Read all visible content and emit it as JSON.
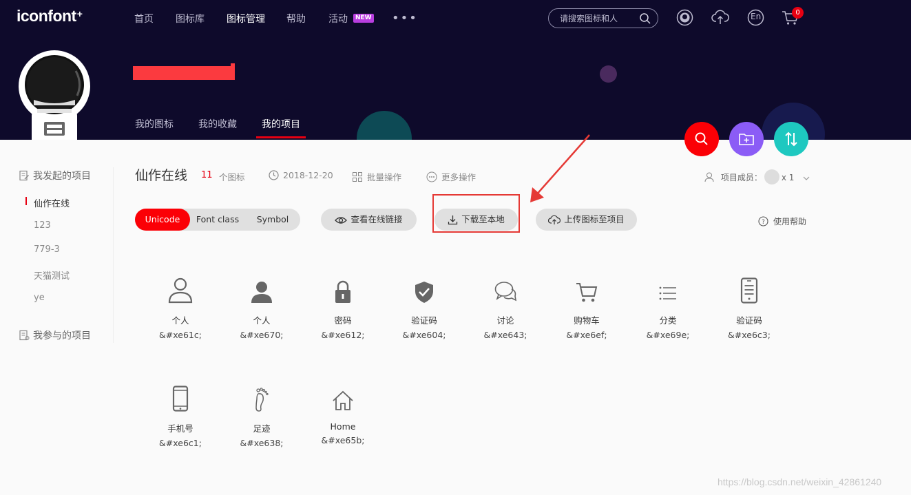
{
  "logo": {
    "text": "iconfont",
    "plus": "+"
  },
  "nav": {
    "items": [
      {
        "label": "首页"
      },
      {
        "label": "图标库"
      },
      {
        "label": "图标管理"
      },
      {
        "label": "帮助"
      },
      {
        "label": "活动"
      }
    ],
    "active": "图标管理",
    "new_badge": "NEW",
    "more": "•••"
  },
  "search": {
    "placeholder": "请搜索图标和人"
  },
  "cart": {
    "count": "0"
  },
  "lang": "En",
  "banner": {
    "tabs": [
      {
        "label": "我的图标"
      },
      {
        "label": "我的收藏"
      },
      {
        "label": "我的项目"
      }
    ],
    "active_tab": "我的项目"
  },
  "sidebar": {
    "started_heading": "我发起的项目",
    "items": [
      {
        "label": "仙作在线"
      },
      {
        "label": "123"
      },
      {
        "label": "779-3"
      },
      {
        "label": "天猫测试"
      },
      {
        "label": "ye"
      }
    ],
    "joined_heading": "我参与的项目"
  },
  "project": {
    "title": "仙作在线",
    "count": "11",
    "count_unit": "个图标",
    "date": "2018-12-20",
    "batch": "批量操作",
    "more_ops": "更多操作",
    "members_label": "项目成员：",
    "members_count": "x 1"
  },
  "toolbar": {
    "formats": [
      {
        "label": "Unicode"
      },
      {
        "label": "Font class"
      },
      {
        "label": "Symbol"
      }
    ],
    "active_format": "Unicode",
    "view_link": "查看在线链接",
    "download": "下载至本地",
    "upload": "上传图标至项目",
    "help": "使用帮助"
  },
  "icons": [
    {
      "name": "个人",
      "code": "&#xe61c;",
      "icon": "user-outline-icon"
    },
    {
      "name": "个人",
      "code": "&#xe670;",
      "icon": "user-filled-icon"
    },
    {
      "name": "密码",
      "code": "&#xe612;",
      "icon": "lock-icon"
    },
    {
      "name": "验证码",
      "code": "&#xe604;",
      "icon": "shield-check-icon"
    },
    {
      "name": "讨论",
      "code": "&#xe643;",
      "icon": "chat-bubbles-icon"
    },
    {
      "name": "购物车",
      "code": "&#xe6ef;",
      "icon": "cart-icon"
    },
    {
      "name": "分类",
      "code": "&#xe69e;",
      "icon": "list-icon"
    },
    {
      "name": "验证码",
      "code": "&#xe6c3;",
      "icon": "phone-list-icon"
    },
    {
      "name": "手机号",
      "code": "&#xe6c1;",
      "icon": "mobile-icon"
    },
    {
      "name": "足迹",
      "code": "&#xe638;",
      "icon": "footprint-icon"
    },
    {
      "name": "Home",
      "code": "&#xe65b;",
      "icon": "home-icon"
    }
  ],
  "colors": {
    "nav_bg": "#0e0a2b",
    "accent": "#fb0006",
    "fab_search": "#fb0006",
    "fab_folder": "#8b5cf6",
    "fab_sort": "#1ec8c0"
  },
  "watermark": "https://blog.csdn.net/weixin_42861240"
}
